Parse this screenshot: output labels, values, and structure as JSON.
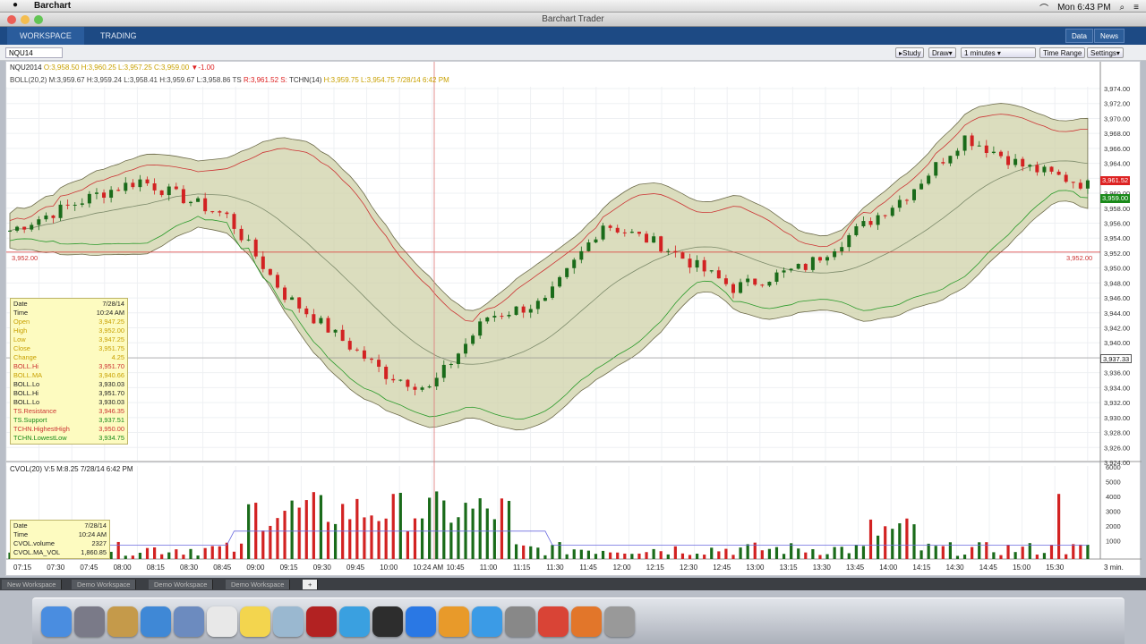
{
  "menubar": {
    "apple": "",
    "app": "Barchart",
    "clock": "Mon 6:43 PM"
  },
  "window": {
    "title": "Barchart Trader"
  },
  "nav": {
    "tabs": [
      "WORKSPACE",
      "TRADING"
    ],
    "right_buttons": [
      "Data",
      "News"
    ]
  },
  "toolbar": {
    "symbol": "NQU14",
    "study": "Study",
    "draw": "Draw",
    "interval": "1 minutes",
    "time_range": "Time Range",
    "settings": "Settings"
  },
  "legend": {
    "line1_symbol": "NQU2014",
    "line1_values": "O:3,958.50  H:3,960.25  L:3,957.25  C:3,959.00",
    "line1_change": "-1.00",
    "line2": "BOLL(20,2)  M:3,959.67  H:3,959.24  L:3,958.41  H:3,959.67  L:3,958.86  TS",
    "line2b": "R:3,961.52  S:",
    "line2c": "TCHN(14)",
    "line2d": "H:3,959.75  L:3,954.75  7/28/14 6:42 PM"
  },
  "data_window": {
    "rows": [
      {
        "k": "Date",
        "v": "7/28/14"
      },
      {
        "k": "Time",
        "v": "10:24 AM"
      },
      {
        "k": "Open",
        "v": "3,947.25"
      },
      {
        "k": "High",
        "v": "3,952.00"
      },
      {
        "k": "Low",
        "v": "3,947.25"
      },
      {
        "k": "Close",
        "v": "3,951.75"
      },
      {
        "k": "Change",
        "v": "4.25"
      },
      {
        "k": "BOLL.Hi",
        "v": "3,951.70"
      },
      {
        "k": "BOLL.MA",
        "v": "3,940.66"
      },
      {
        "k": "BOLL.Lo",
        "v": "3,930.03"
      },
      {
        "k": "BOLL.Hi",
        "v": "3,951.70"
      },
      {
        "k": "BOLL.Lo",
        "v": "3,930.03"
      },
      {
        "k": "TS.Resistance",
        "v": "3,946.35"
      },
      {
        "k": "TS.Support",
        "v": "3,937.51"
      },
      {
        "k": "TCHN.HighestHigh",
        "v": "3,950.00"
      },
      {
        "k": "TCHN.LowestLow",
        "v": "3,934.75"
      }
    ]
  },
  "vol_legend": "CVOL(20)  V:5  M:8.25  7/28/14 6:42 PM",
  "vol_window": {
    "rows": [
      {
        "k": "Date",
        "v": "7/28/14"
      },
      {
        "k": "Time",
        "v": "10:24 AM"
      },
      {
        "k": "CVOL.volume",
        "v": "2327"
      },
      {
        "k": "CVOL.MA_VOL",
        "v": "1,860.85"
      }
    ]
  },
  "price_axis": [
    "3,974.00",
    "3,972.00",
    "3,970.00",
    "3,968.00",
    "3,966.00",
    "3,964.00",
    "3,962.00",
    "3,960.00",
    "3,958.00",
    "3,956.00",
    "3,954.00",
    "3,952.00",
    "3,950.00",
    "3,948.00",
    "3,946.00",
    "3,944.00",
    "3,942.00",
    "3,940.00",
    "3,938.00",
    "3,936.00",
    "3,934.00",
    "3,932.00",
    "3,930.00",
    "3,928.00",
    "3,926.00",
    "3,924.00"
  ],
  "vol_axis": [
    "6000",
    "5000",
    "4000",
    "3000",
    "2000",
    "1000"
  ],
  "time_axis": [
    "07:15",
    "07:30",
    "07:45",
    "08:00",
    "08:15",
    "08:30",
    "08:45",
    "09:00",
    "09:15",
    "09:30",
    "09:45",
    "10:00",
    "10:24 AM",
    "10:45",
    "11:00",
    "11:15",
    "11:30",
    "11:45",
    "12:00",
    "12:15",
    "12:30",
    "12:45",
    "13:00",
    "13:15",
    "13:30",
    "13:45",
    "14:00",
    "14:15",
    "14:30",
    "14:45",
    "15:00",
    "15:30"
  ],
  "time_axis_unit": "3 min.",
  "price_tags": {
    "red": "3,961.52",
    "green": "3,959.00",
    "cursor": "3,937.33",
    "hline_left": "3,952.00",
    "hline_right": "3,952.00"
  },
  "workspaces": [
    "New Workspace",
    "Demo Workspace",
    "Demo Workspace",
    "Demo Workspace"
  ],
  "colors": {
    "up": "#1a6b1a",
    "down": "#d22222",
    "band": "#cfd2a8",
    "nav": "#1d4a84"
  },
  "dock_icons": [
    "finder-icon",
    "launchpad-icon",
    "contacts-icon",
    "safari-icon",
    "mail-icon",
    "calendar-icon",
    "notes-icon",
    "preview-icon",
    "photobooth-icon",
    "messages-icon",
    "facetime-icon",
    "itunes-icon",
    "ibooks-icon",
    "appstore-icon",
    "preferences-icon",
    "chrome-icon",
    "firefox-icon",
    "trash-icon"
  ]
}
